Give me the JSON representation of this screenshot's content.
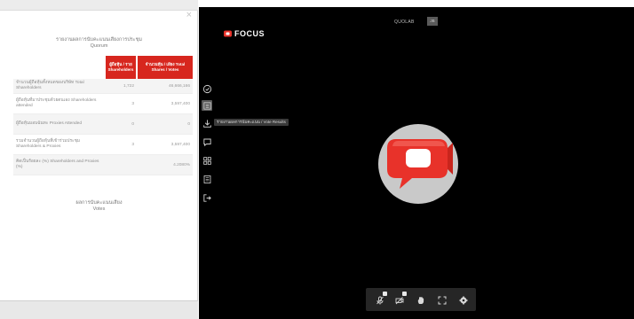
{
  "left_panel": {
    "close_symbol": "×",
    "title": "รายงานผลการนับคะแนนเสียงการประชุม",
    "subtitle": "Quorum",
    "table": {
      "headers": [
        "ผู้ถือหุ้น / ราย Shareholders",
        "จำนวนหุ้น / เสียง Total Shares / Votes"
      ],
      "rows": [
        {
          "label": "จำนวนผู้ถือหุ้นทั้งหมดของบริษัท Total Shareholders",
          "count": "1,722",
          "shares": "46,666,166"
        },
        {
          "label": "ผู้ถือหุ้นที่มาประชุมด้วยตนเอง Shareholders attended",
          "count": "3",
          "shares": "3,597,400"
        },
        {
          "label": "ผู้ถือหุ้นมอบฉันทะ Proxies Attended",
          "count": "0",
          "shares": "0"
        },
        {
          "label": "รวมจำนวนผู้ถือหุ้นที่เข้าร่วมประชุม Shareholders & Proxies",
          "count": "3",
          "shares": "3,597,400"
        },
        {
          "label": "คิดเป็นร้อยละ (%) Shareholders and Proxies (%)",
          "count": "",
          "shares": "4.2080%"
        }
      ]
    },
    "video_heading": "ผลการนับคะแนนเสียง",
    "video_subheading": "Votes"
  },
  "stage": {
    "logo_text": "FOCUS",
    "room_name": "QUOLAB",
    "user_badge": "JB",
    "tooltip": "รายงานผลการนับคะแนน / Vote Results",
    "sidebar_icons": [
      "check-circle-icon",
      "list-report-icon",
      "download-icon",
      "chat-icon",
      "grid-icon",
      "document-icon",
      "exit-icon"
    ],
    "control_icons": [
      "microphone-icon",
      "camera-icon",
      "raise-hand-icon",
      "fullscreen-icon",
      "settings-icon"
    ],
    "accent_color": "#e8322a"
  }
}
